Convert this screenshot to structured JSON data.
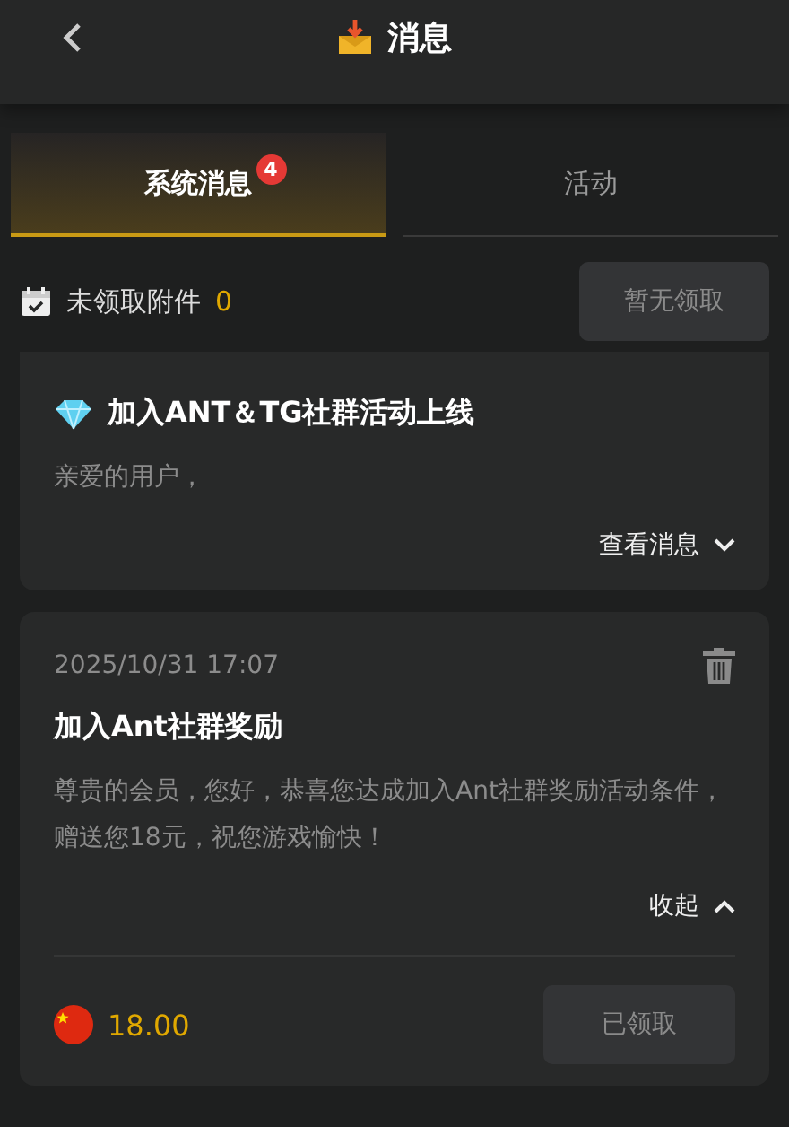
{
  "header": {
    "title": "消息"
  },
  "tabs": [
    {
      "label": "系统消息",
      "selected": true,
      "badge": "4"
    },
    {
      "label": "活动",
      "selected": false
    }
  ],
  "attachments": {
    "label": "未领取附件",
    "count": "0",
    "button": {
      "label": "暂无领取",
      "disabled": true
    }
  },
  "messages": [
    {
      "kind": "activity",
      "title": "加入ANT＆TG社群活动上线",
      "body": "亲爱的用户，",
      "toggle": "查看消息",
      "expanded": false
    },
    {
      "kind": "reward",
      "date": "2025/10/31 17:07",
      "title": "加入Ant社群奖励",
      "body": "尊贵的会员，您好，恭喜您达成加入Ant社群奖励活动条件，赠送您18元，祝您游戏愉快！",
      "toggle": "收起",
      "expanded": true,
      "amount": "18.00",
      "button": {
        "label": "已领取",
        "disabled": true
      }
    }
  ]
}
